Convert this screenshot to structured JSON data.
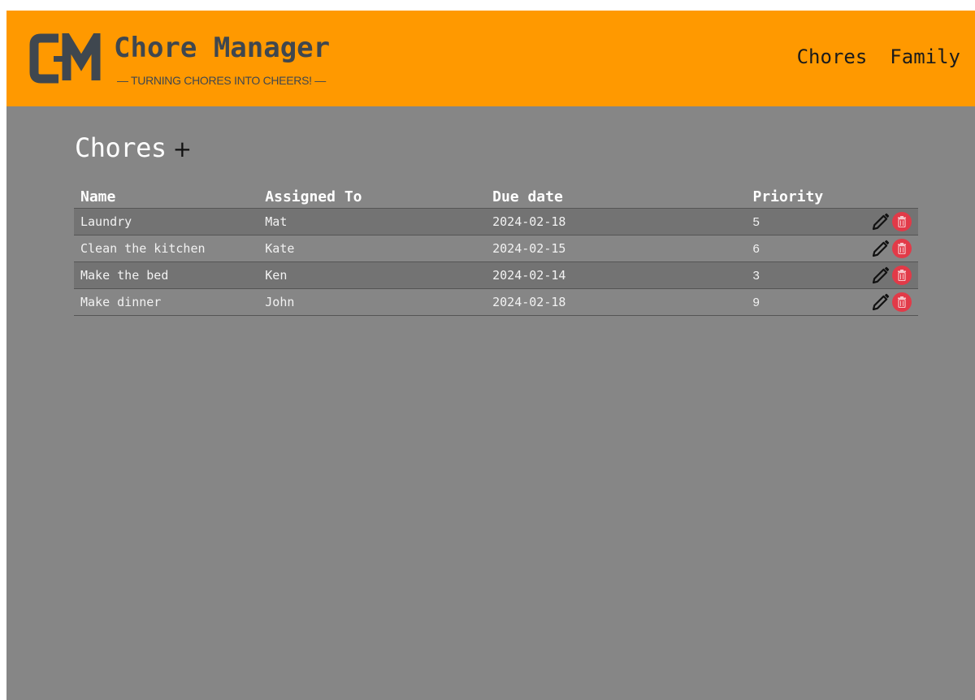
{
  "brand": {
    "logo_letters": "CM",
    "title": "Chore Manager",
    "tagline": "— TURNING CHORES INTO CHEERS! —"
  },
  "nav": {
    "items": [
      {
        "label": "Chores"
      },
      {
        "label": "Family"
      }
    ]
  },
  "page": {
    "title": "Chores",
    "add_icon": "+"
  },
  "table": {
    "columns": [
      "Name",
      "Assigned To",
      "Due date",
      "Priority"
    ],
    "rows": [
      {
        "name": "Laundry",
        "assigned_to": "Mat",
        "due_date": "2024-02-18",
        "priority": "5"
      },
      {
        "name": "Clean the kitchen",
        "assigned_to": "Kate",
        "due_date": "2024-02-15",
        "priority": "6"
      },
      {
        "name": "Make the bed",
        "assigned_to": "Ken",
        "due_date": "2024-02-14",
        "priority": "3"
      },
      {
        "name": "Make dinner",
        "assigned_to": "John",
        "due_date": "2024-02-18",
        "priority": "9"
      }
    ],
    "row_actions": [
      "pencil-icon",
      "trash-icon"
    ]
  },
  "colors": {
    "header_bg": "#ff9900",
    "page_bg": "#868686",
    "row_alt_bg": "#737373",
    "brand_text": "#3f474f",
    "delete_accent": "#e23a48"
  }
}
